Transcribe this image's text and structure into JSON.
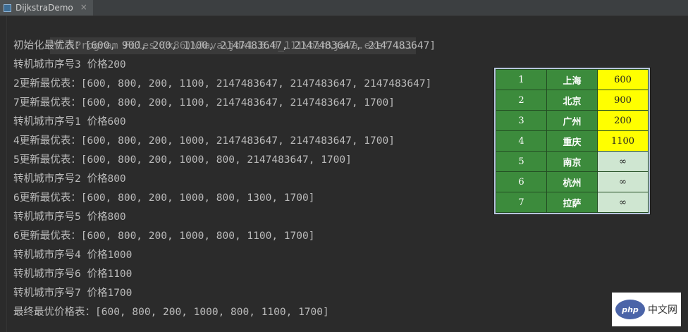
{
  "tab": {
    "title": "DijkstraDemo",
    "close_glyph": "×",
    "icon": "run-config-icon"
  },
  "console": {
    "command": "\"C:\\Program Files (x86)\\Java\\jdk1.8.0_111\\bin\\java.exe\" ...",
    "lines": [
      "初始化最优表：[600, 900, 200, 1100, 2147483647, 2147483647, 2147483647]",
      "转机城市序号3 价格200",
      "2更新最优表：[600, 800, 200, 1100, 2147483647, 2147483647, 2147483647]",
      "7更新最优表：[600, 800, 200, 1100, 2147483647, 2147483647, 1700]",
      "转机城市序号1 价格600",
      "4更新最优表：[600, 800, 200, 1000, 2147483647, 2147483647, 1700]",
      "5更新最优表：[600, 800, 200, 1000, 800, 2147483647, 1700]",
      "转机城市序号2 价格800",
      "6更新最优表：[600, 800, 200, 1000, 800, 1300, 1700]",
      "转机城市序号5 价格800",
      "6更新最优表：[600, 800, 200, 1000, 800, 1100, 1700]",
      "转机城市序号4 价格1000",
      "转机城市序号6 价格1100",
      "转机城市序号7 价格1700",
      "最终最优价格表：[600, 800, 200, 1000, 800, 1100, 1700]"
    ]
  },
  "price_table": {
    "rows": [
      {
        "index": "1",
        "city": "上海",
        "price": "600",
        "status": "known"
      },
      {
        "index": "2",
        "city": "北京",
        "price": "900",
        "status": "known"
      },
      {
        "index": "3",
        "city": "广州",
        "price": "200",
        "status": "known"
      },
      {
        "index": "4",
        "city": "重庆",
        "price": "1100",
        "status": "known"
      },
      {
        "index": "5",
        "city": "南京",
        "price": "∞",
        "status": "inf"
      },
      {
        "index": "6",
        "city": "杭州",
        "price": "∞",
        "status": "inf"
      },
      {
        "index": "7",
        "city": "拉萨",
        "price": "∞",
        "status": "inf"
      }
    ]
  },
  "watermark": {
    "logo_text": "php",
    "text": "中文网"
  },
  "colors": {
    "background": "#2b2b2b",
    "console_text": "#bbbbbb",
    "table_green": "#3c8b3c",
    "known_price": "#ffff00",
    "infinite_price": "#cfe6d1"
  }
}
